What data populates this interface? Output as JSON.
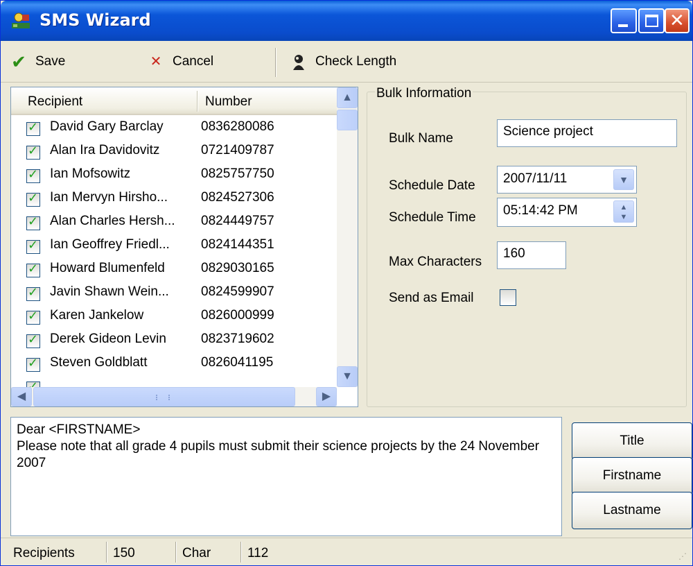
{
  "window": {
    "title": "SMS Wizard",
    "icon": "sms-wizard-app-icon"
  },
  "toolbar": {
    "save_label": "Save",
    "cancel_label": "Cancel",
    "check_length_label": "Check Length"
  },
  "recipients_list": {
    "columns": [
      "Recipient",
      "Number"
    ],
    "rows": [
      {
        "name": "David Gary Barclay",
        "number": "0836280086",
        "checked": true
      },
      {
        "name": "Alan Ira Davidovitz",
        "number": "0721409787",
        "checked": true
      },
      {
        "name": "Ian Mofsowitz",
        "number": "0825757750",
        "checked": true
      },
      {
        "name": "Ian Mervyn Hirsho...",
        "number": "0824527306",
        "checked": true
      },
      {
        "name": "Alan Charles Hersh...",
        "number": "0824449757",
        "checked": true
      },
      {
        "name": "Ian Geoffrey Friedl...",
        "number": "0824144351",
        "checked": true
      },
      {
        "name": "Howard Blumenfeld",
        "number": "0829030165",
        "checked": true
      },
      {
        "name": "Javin Shawn Wein...",
        "number": "0824599907",
        "checked": true
      },
      {
        "name": "Karen Jankelow",
        "number": "0826000999",
        "checked": true
      },
      {
        "name": "Derek Gideon Levin",
        "number": "0823719602",
        "checked": true
      },
      {
        "name": "Steven Goldblatt",
        "number": "0826041195",
        "checked": true
      }
    ]
  },
  "bulk_info": {
    "legend": "Bulk Information",
    "bulk_name_label": "Bulk Name",
    "bulk_name_value": "Science project",
    "schedule_date_label": "Schedule Date",
    "schedule_date_value": "2007/11/11",
    "schedule_time_label": "Schedule Time",
    "schedule_time_value": "05:14:42 PM",
    "max_chars_label": "Max Characters",
    "max_chars_value": "160",
    "send_email_label": "Send as Email",
    "send_email_checked": false
  },
  "message": {
    "line1": "Dear <FIRSTNAME>",
    "line2": "Please note that all grade 4 pupils must submit their science projects by the 24 November 2007"
  },
  "placeholders": {
    "title_label": "Title",
    "firstname_label": "Firstname",
    "lastname_label": "Lastname"
  },
  "status_bar": {
    "recipients_label": "Recipients",
    "recipients_count": "150",
    "char_label": "Char",
    "char_count": "112"
  },
  "colors": {
    "titlebar": "#0a4ccc",
    "close_button": "#d8502e",
    "checkmark": "#21a121",
    "window_bg": "#ece9d8"
  }
}
